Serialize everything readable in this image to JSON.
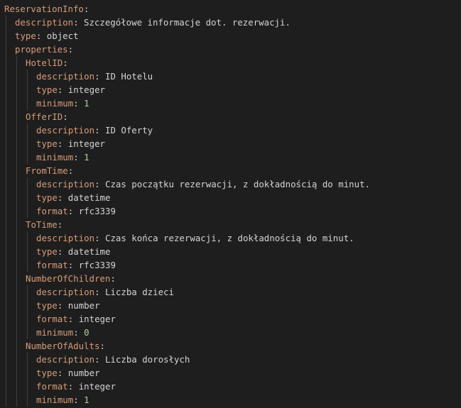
{
  "editor": {
    "colors": {
      "background": "#1e1e1e",
      "key": "#d79c7a",
      "text": "#d4d4d4",
      "number": "#b5cea8",
      "indent_guide": "#404040"
    },
    "lines": [
      {
        "depth": 0,
        "key": "ReservationInfo",
        "value": ""
      },
      {
        "depth": 1,
        "key": "description",
        "value": "Szczegółowe informacje dot. rezerwacji."
      },
      {
        "depth": 1,
        "key": "type",
        "value": "object"
      },
      {
        "depth": 1,
        "key": "properties",
        "value": ""
      },
      {
        "depth": 2,
        "key": "HotelID",
        "value": ""
      },
      {
        "depth": 3,
        "key": "description",
        "value": "ID Hotelu"
      },
      {
        "depth": 3,
        "key": "type",
        "value": "integer"
      },
      {
        "depth": 3,
        "key": "minimum",
        "value": "1",
        "numeric": true
      },
      {
        "depth": 2,
        "key": "OfferID",
        "value": ""
      },
      {
        "depth": 3,
        "key": "description",
        "value": "ID Oferty"
      },
      {
        "depth": 3,
        "key": "type",
        "value": "integer"
      },
      {
        "depth": 3,
        "key": "minimum",
        "value": "1",
        "numeric": true
      },
      {
        "depth": 2,
        "key": "FromTime",
        "value": ""
      },
      {
        "depth": 3,
        "key": "description",
        "value": "Czas początku rezerwacji, z dokładnością do minut."
      },
      {
        "depth": 3,
        "key": "type",
        "value": "datetime"
      },
      {
        "depth": 3,
        "key": "format",
        "value": "rfc3339"
      },
      {
        "depth": 2,
        "key": "ToTime",
        "value": ""
      },
      {
        "depth": 3,
        "key": "description",
        "value": "Czas końca rezerwacji, z dokładnością do minut."
      },
      {
        "depth": 3,
        "key": "type",
        "value": "datetime"
      },
      {
        "depth": 3,
        "key": "format",
        "value": "rfc3339"
      },
      {
        "depth": 2,
        "key": "NumberOfChildren",
        "value": ""
      },
      {
        "depth": 3,
        "key": "description",
        "value": "Liczba dzieci"
      },
      {
        "depth": 3,
        "key": "type",
        "value": "number"
      },
      {
        "depth": 3,
        "key": "format",
        "value": "integer"
      },
      {
        "depth": 3,
        "key": "minimum",
        "value": "0",
        "numeric": true
      },
      {
        "depth": 2,
        "key": "NumberOfAdults",
        "value": ""
      },
      {
        "depth": 3,
        "key": "description",
        "value": "Liczba dorosłych"
      },
      {
        "depth": 3,
        "key": "type",
        "value": "number"
      },
      {
        "depth": 3,
        "key": "format",
        "value": "integer"
      },
      {
        "depth": 3,
        "key": "minimum",
        "value": "1",
        "numeric": true
      }
    ]
  }
}
